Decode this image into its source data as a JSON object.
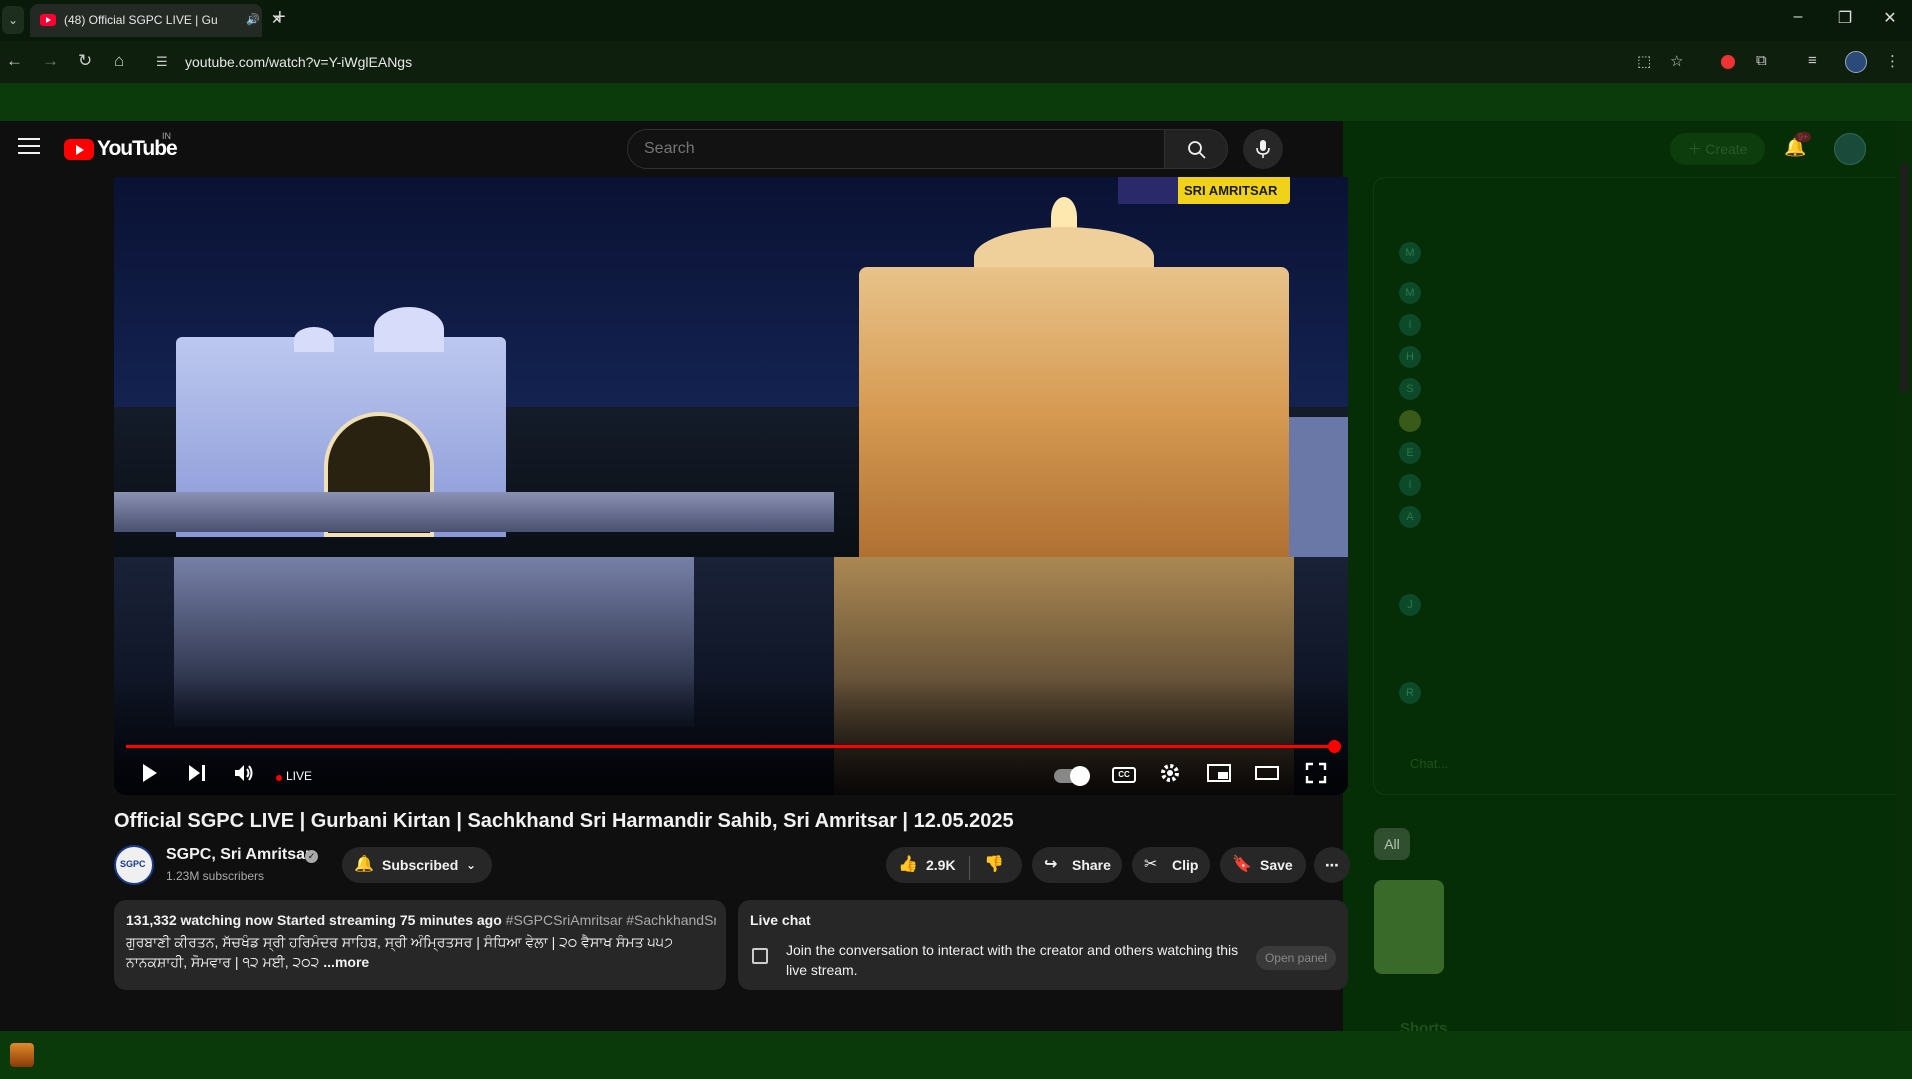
{
  "browser": {
    "tab_title": "(48) Official SGPC LIVE | Gu",
    "tab_audio_icon": "speaker-icon",
    "url": "youtube.com/watch?v=Y-iWglEANgs"
  },
  "youtube": {
    "logo_text": "YouTube",
    "region": "IN",
    "search_placeholder": "Search",
    "create_label": "Create",
    "notification_badge": "9+"
  },
  "player": {
    "badge_text": "SRI AMRITSAR",
    "live_label": "LIVE",
    "progress": 1.0
  },
  "video": {
    "title": "Official SGPC LIVE | Gurbani Kirtan | Sachkhand Sri Harmandir Sahib, Sri Amritsar | 12.05.2025",
    "channel_name": "SGPC, Sri Amritsar",
    "channel_avatar_text": "SGPC",
    "subscribers": "1.23M subscribers",
    "subscribe_label": "Subscribed",
    "likes": "2.9K",
    "share_label": "Share",
    "clip_label": "Clip",
    "save_label": "Save"
  },
  "description": {
    "stats": "131,332 watching now  Started streaming 75 minutes ago",
    "tags": "#SGPCSriAmritsar #SachkhandSri",
    "body": "ਗੁਰਬਾਣੀ ਕੀਰਤਨ, ਸੱਚਖੰਡ ਸ੍ਰੀ ਹਰਿਮੰਦਰ ਸਾਹਿਬ, ਸ੍ਰੀ ਅੰਮ੍ਰਿਤਸਰ | ਸੰਧਿਆ ਵੇਲਾ | ੨੦ ਵੈਸਾਖ ਸੰਮਤ ੫੫੭ ਨਾਨਕਸ਼ਾਹੀ, ਸੋਮਵਾਰ | ੧੨ ਮਈ, ੨੦੨",
    "more_label": "...more"
  },
  "live_chat": {
    "title": "Live chat",
    "text": "Join the conversation to interact with the creator and others watching this live stream.",
    "open_panel_label": "Open panel"
  },
  "sidebar": {
    "chip_all": "All",
    "chat_avatars": [
      "M",
      "M",
      "I",
      "H",
      "S",
      "",
      "E",
      "I",
      "A",
      "J",
      "R"
    ],
    "chat_input_ghost": "Chat...",
    "shorts_ghost": "Shorts"
  },
  "colors": {
    "accent": "#ff0000",
    "background": "#0f0f0f",
    "overlay_green": "#062e06"
  }
}
